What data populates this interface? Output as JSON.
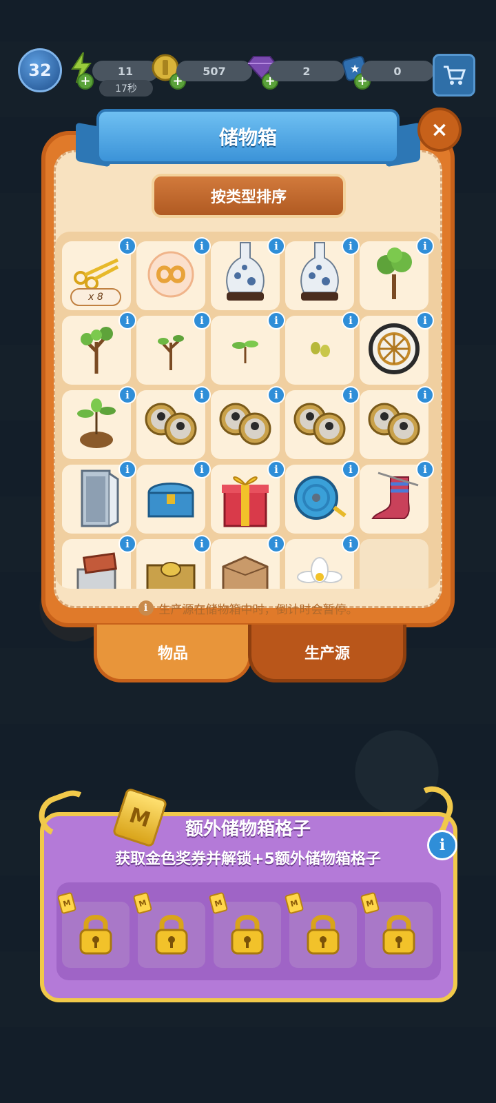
{
  "topbar": {
    "level": "32",
    "energy": "11",
    "energy_timer": "17秒",
    "coins": "507",
    "gems": "2",
    "stars": "0"
  },
  "dialog": {
    "title": "储物箱",
    "close_label": "×",
    "sort_label": "按类型排序",
    "note": "生产源在储物箱中时，倒计时会暂停。",
    "tabs": [
      "物品",
      "生产源"
    ],
    "active_tab": "生产源",
    "info_label": "i",
    "items": [
      {
        "icon": "golden-scissors",
        "qty": "x 8"
      },
      {
        "icon": "infinity-orb"
      },
      {
        "icon": "blue-white-vase"
      },
      {
        "icon": "blue-white-vase"
      },
      {
        "icon": "large-tree"
      },
      {
        "icon": "medium-tree"
      },
      {
        "icon": "small-tree"
      },
      {
        "icon": "sprout"
      },
      {
        "icon": "seeds"
      },
      {
        "icon": "wagon-wheel"
      },
      {
        "icon": "potted-plant"
      },
      {
        "icon": "photo-locket"
      },
      {
        "icon": "photo-locket"
      },
      {
        "icon": "photo-locket"
      },
      {
        "icon": "photo-locket"
      },
      {
        "icon": "cabinet"
      },
      {
        "icon": "blue-chest"
      },
      {
        "icon": "gift-box"
      },
      {
        "icon": "hose-reel"
      },
      {
        "icon": "knitting-sock"
      },
      {
        "icon": "toolbox"
      },
      {
        "icon": "gold-chest"
      },
      {
        "icon": "cardboard-box"
      },
      {
        "icon": "water-lily"
      },
      {
        "icon": "empty"
      }
    ]
  },
  "extra_slots": {
    "title": "额外储物箱格子",
    "subtitle": "获取金色奖券并解锁+5额外储物箱格子",
    "ticket_letter": "M",
    "info_label": "i",
    "slots": 5
  },
  "colors": {
    "dialog_orange": "#e07a2a",
    "panel_cream": "#f8e2c0",
    "banner_blue": "#3b93d8",
    "extra_purple": "#b47ad8",
    "gold": "#f1c94a"
  }
}
